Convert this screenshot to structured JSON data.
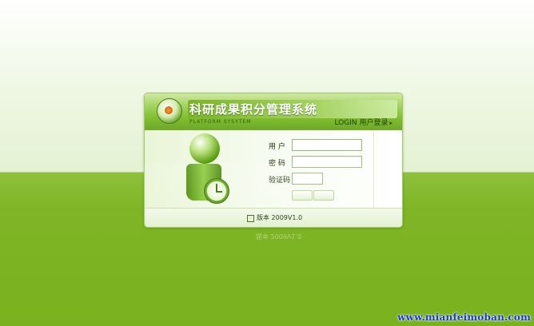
{
  "app": {
    "title": "科研成果积分管理系统",
    "subtitle": "PLATFORM SYSYTEM",
    "login_link": "LOGIN 用户登录",
    "login_arrow": "▸"
  },
  "form": {
    "user_label": "用 户",
    "password_label": "密 码",
    "captcha_label": "验证码",
    "user_value": "",
    "password_value": "",
    "captcha_value": ""
  },
  "footer": {
    "version": "版本 2009V1.0"
  },
  "reflection": {
    "version": "版本 2009V1.0"
  },
  "watermark": "www.mianfeimoban.com",
  "colors": {
    "accent_green": "#79b11f",
    "header_green": "#9cd056",
    "watermark_blue": "#1c39c8"
  },
  "icons": {
    "logo": "target-logo-icon",
    "figure": "user-clock-icon",
    "version": "document-icon"
  }
}
